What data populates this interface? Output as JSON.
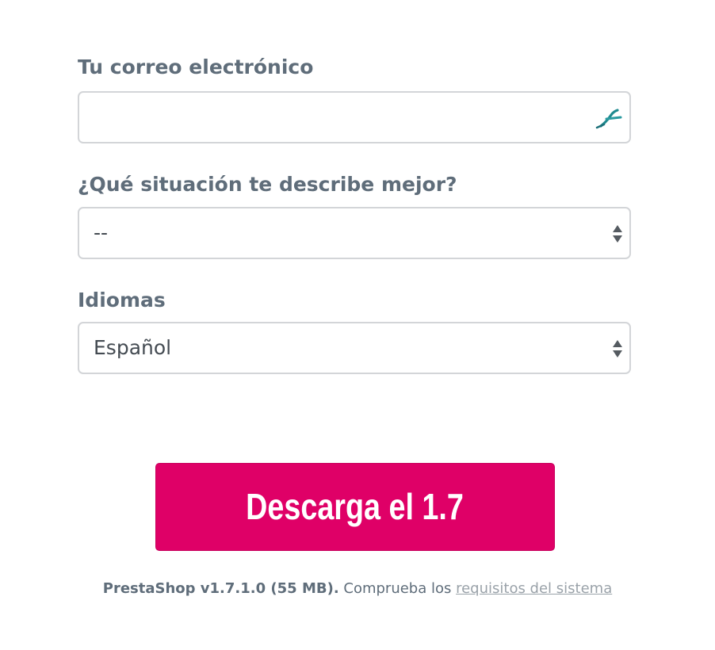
{
  "form": {
    "email": {
      "label": "Tu correo electrónico",
      "value": "",
      "icon": "autofill-key-icon"
    },
    "situation": {
      "label": "¿Qué situación te describe mejor?",
      "selected": "--"
    },
    "language": {
      "label": "Idiomas",
      "selected": "Español"
    }
  },
  "download": {
    "button_label": "Descarga el 1.7",
    "version_text": "PrestaShop v1.7.1.0 (55 MB).",
    "check_text": " Comprueba los ",
    "requirements_link": "requisitos del sistema"
  },
  "colors": {
    "label": "#5f6d7a",
    "button": "#df0067",
    "border": "#d3d5d8",
    "link": "#9aa2a9"
  }
}
